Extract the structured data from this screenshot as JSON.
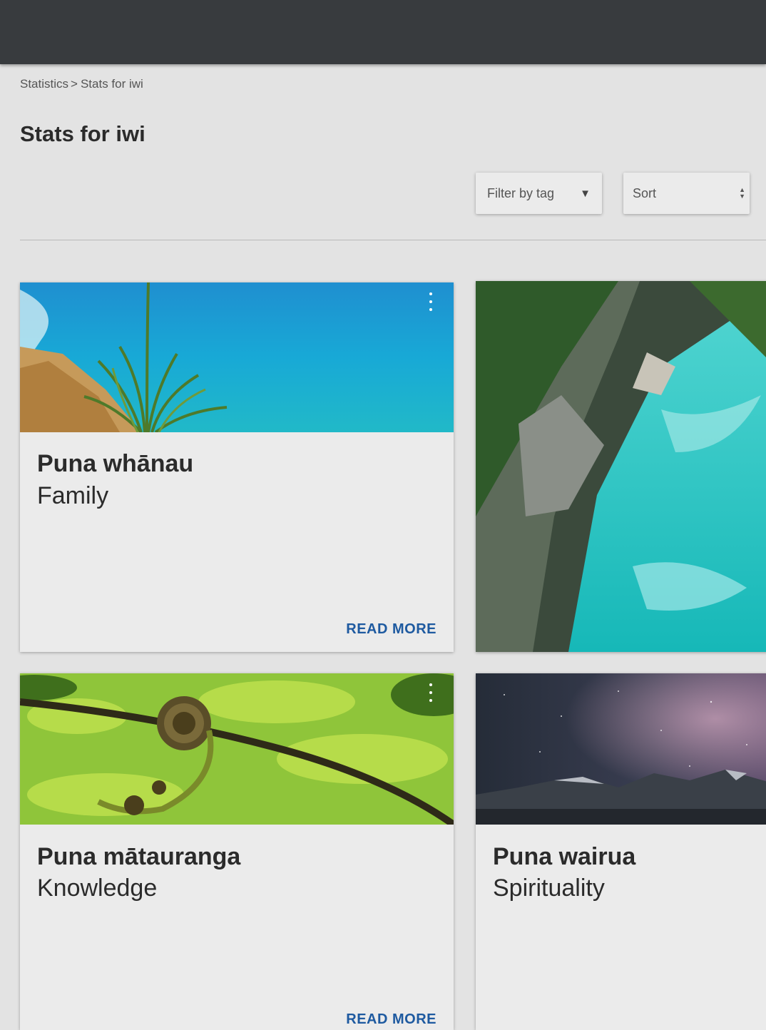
{
  "breadcrumb": {
    "items": [
      "Statistics",
      "Stats for iwi"
    ],
    "separator": ">"
  },
  "page": {
    "title": "Stats for iwi"
  },
  "controls": {
    "filter_label": "Filter by tag",
    "sort_label": "Sort"
  },
  "cards": [
    {
      "title": "Puna whānau",
      "subtitle": "Family",
      "link": "READ MORE",
      "image": "coastal-cliff-photo"
    },
    {
      "title": "",
      "subtitle": "",
      "link": "",
      "image": "river-gorge-photo"
    },
    {
      "title": "Puna mātauranga",
      "subtitle": "Knowledge",
      "link": "READ MORE",
      "image": "fern-frond-photo"
    },
    {
      "title": "Puna wairua",
      "subtitle": "Spirituality",
      "link": "",
      "image": "night-sky-photo"
    }
  ],
  "colors": {
    "topbar": "#383b3e",
    "background": "#e3e3e3",
    "card": "#ebebeb",
    "link": "#1e5aa0"
  }
}
